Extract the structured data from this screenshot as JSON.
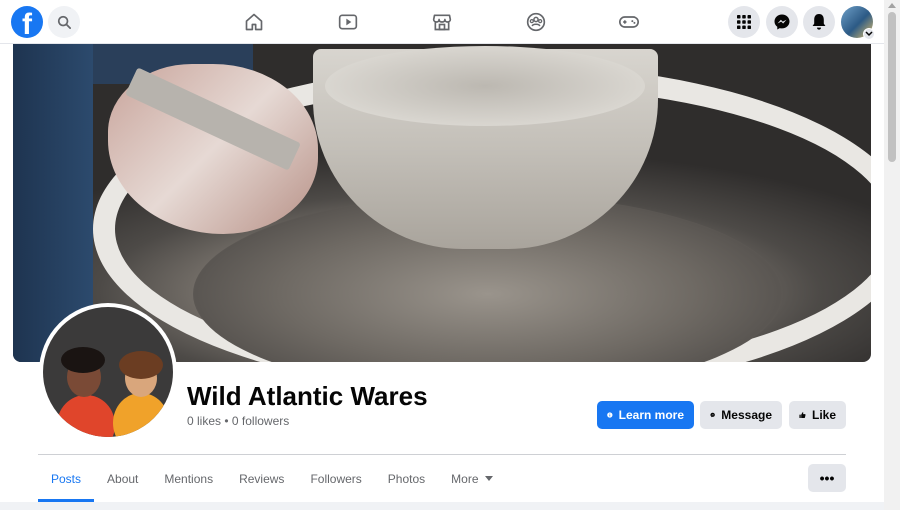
{
  "nav": {
    "logo_letter": "f",
    "icons": [
      "home-icon",
      "watch-icon",
      "marketplace-icon",
      "groups-icon",
      "gaming-icon"
    ],
    "right_icons": [
      "menu-grid-icon",
      "messenger-icon",
      "notifications-icon"
    ]
  },
  "page": {
    "name": "Wild Atlantic Wares",
    "stats": "0 likes • 0 followers"
  },
  "actions": {
    "learn_more": "Learn more",
    "message": "Message",
    "like": "Like"
  },
  "tabs": [
    {
      "label": "Posts",
      "active": true
    },
    {
      "label": "About",
      "active": false
    },
    {
      "label": "Mentions",
      "active": false
    },
    {
      "label": "Reviews",
      "active": false
    },
    {
      "label": "Followers",
      "active": false
    },
    {
      "label": "Photos",
      "active": false
    },
    {
      "label": "More",
      "active": false
    }
  ],
  "more_menu": "•••",
  "colors": {
    "brand": "#1877f2",
    "secondary_button": "#e4e6eb",
    "muted_text": "#65676b"
  }
}
